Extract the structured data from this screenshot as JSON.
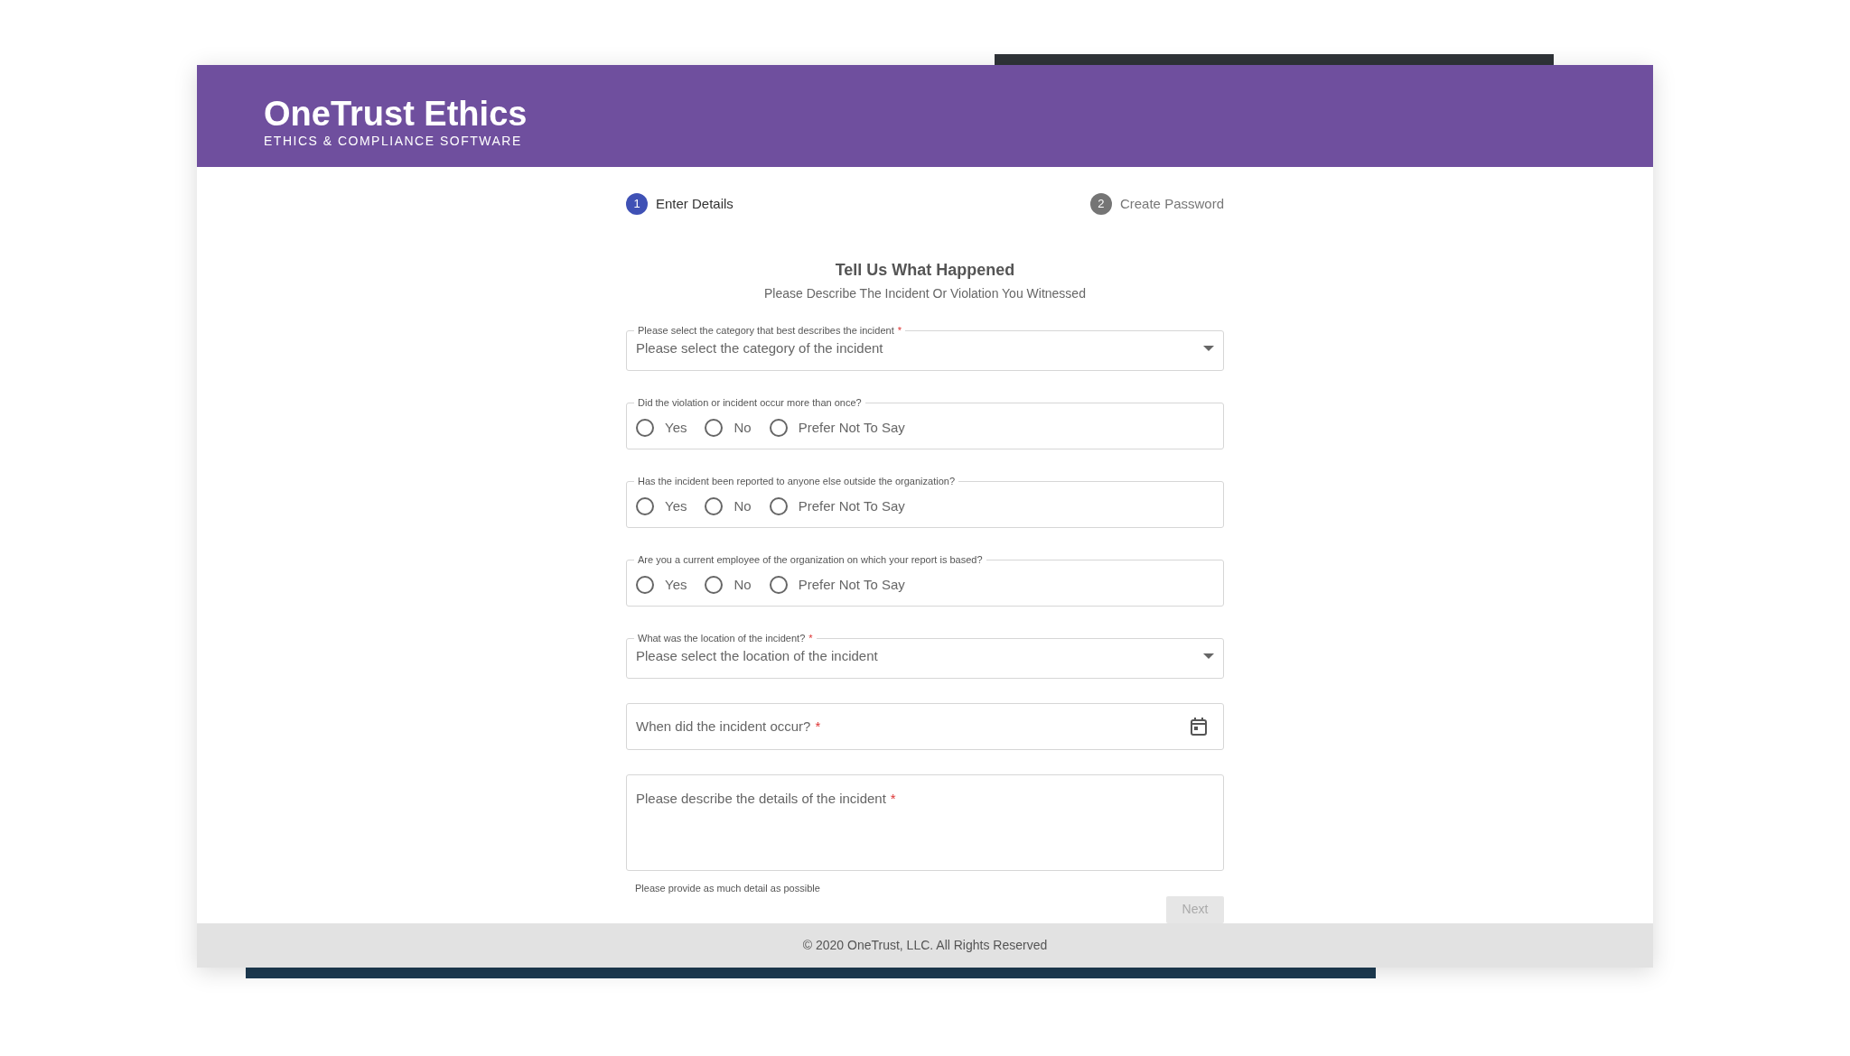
{
  "header": {
    "brand": "OneTrust Ethics",
    "tagline": "ETHICS & COMPLIANCE SOFTWARE"
  },
  "steps": [
    {
      "number": "1",
      "label": "Enter Details",
      "selected": true
    },
    {
      "number": "2",
      "label": "Create Password",
      "selected": false
    }
  ],
  "form": {
    "title": "Tell Us What Happened",
    "subtitle": "Please Describe The Incident Or Violation You Witnessed",
    "fields": [
      {
        "kind": "select",
        "legend": "Please select the category that best describes the incident",
        "required_mark": "*",
        "placeholder": "Please select the category of the incident"
      },
      {
        "kind": "radio",
        "legend": "Did the violation or incident occur more than once?",
        "options": [
          {
            "label": "Yes",
            "selected": false
          },
          {
            "label": "No",
            "selected": false
          },
          {
            "label": "Prefer Not To Say",
            "selected": false
          }
        ]
      },
      {
        "kind": "radio",
        "legend": "Has the incident been reported to anyone else outside the organization?",
        "options": [
          {
            "label": "Yes",
            "selected": false
          },
          {
            "label": "No",
            "selected": false
          },
          {
            "label": "Prefer Not To Say",
            "selected": false
          }
        ]
      },
      {
        "kind": "radio",
        "legend": "Are you a current employee of the organization on which your report is based?",
        "options": [
          {
            "label": "Yes",
            "selected": false
          },
          {
            "label": "No",
            "selected": false
          },
          {
            "label": "Prefer Not To Say",
            "selected": false
          }
        ]
      },
      {
        "kind": "select",
        "legend": "What was the location of the incident?",
        "required_mark": "*",
        "placeholder": "Please select the location of the incident"
      },
      {
        "kind": "date",
        "placeholder": "When did the incident occur?",
        "required_mark": "*"
      },
      {
        "kind": "textarea",
        "placeholder": "Please describe the details of the incident",
        "required_mark": "*",
        "helper": "Please provide as much detail as possible"
      }
    ],
    "next_button": {
      "label": "Next",
      "disabled": true
    }
  },
  "footer": {
    "text": "© 2020 OneTrust, LLC. All Rights Reserved"
  }
}
